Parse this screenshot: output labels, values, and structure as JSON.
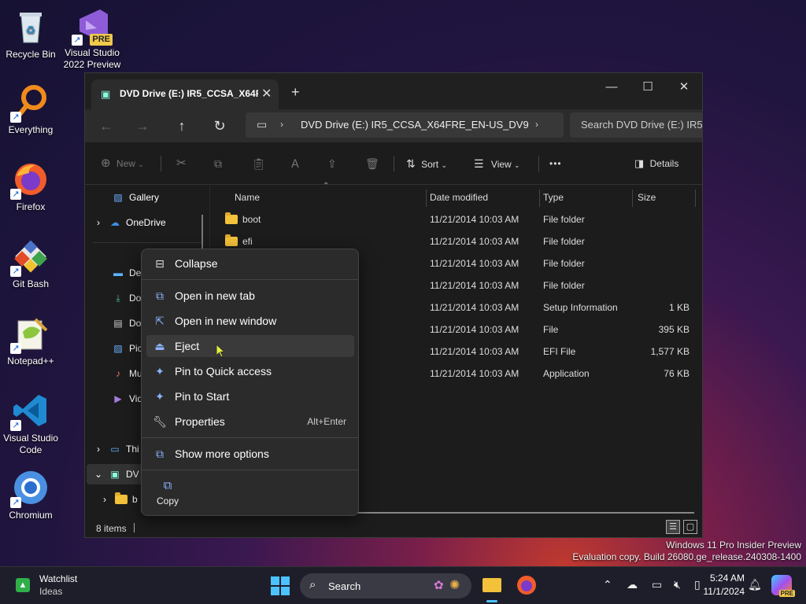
{
  "desktop": {
    "icons": [
      {
        "label": "Recycle Bin"
      },
      {
        "label": "Visual Studio 2022 Preview",
        "badge": "PRE"
      },
      {
        "label": "Everything"
      },
      {
        "label": "Firefox"
      },
      {
        "label": "Git Bash"
      },
      {
        "label": "Notepad++"
      },
      {
        "label": "Visual Studio Code"
      },
      {
        "label": "Chromium"
      }
    ]
  },
  "window": {
    "tab_title": "DVD Drive (E:) IR5_CCSA_X64F",
    "address": "DVD Drive (E:) IR5_CCSA_X64FRE_EN-US_DV9",
    "search_placeholder": "Search DVD Drive (E:) IR5",
    "commands": {
      "new": "New",
      "sort": "Sort",
      "view": "View",
      "more": "•••",
      "details": "Details"
    },
    "sidebar": {
      "gallery": "Gallery",
      "onedrive": "OneDrive",
      "items": [
        "Des",
        "Do",
        "Do",
        "Pic",
        "Mu",
        "Vid"
      ],
      "thispc": "Thi",
      "dvd": "DV",
      "sub": "b"
    },
    "columns": {
      "name": "Name",
      "date": "Date modified",
      "type": "Type",
      "size": "Size"
    },
    "rows": [
      {
        "name": "boot",
        "date": "11/21/2014 10:03 AM",
        "type": "File folder",
        "size": ""
      },
      {
        "name": "efi",
        "date": "11/21/2014 10:03 AM",
        "type": "File folder",
        "size": ""
      },
      {
        "name": "",
        "date": "11/21/2014 10:03 AM",
        "type": "File folder",
        "size": ""
      },
      {
        "name": "",
        "date": "11/21/2014 10:03 AM",
        "type": "File folder",
        "size": ""
      },
      {
        "name": "",
        "date": "11/21/2014 10:03 AM",
        "type": "Setup Information",
        "size": "1 KB"
      },
      {
        "name": "",
        "date": "11/21/2014 10:03 AM",
        "type": "File",
        "size": "395 KB"
      },
      {
        "name": "",
        "date": "11/21/2014 10:03 AM",
        "type": "EFI File",
        "size": "1,577 KB"
      },
      {
        "name": "",
        "date": "11/21/2014 10:03 AM",
        "type": "Application",
        "size": "76 KB"
      }
    ],
    "status": "8 items"
  },
  "context_menu": {
    "collapse": "Collapse",
    "open_new_tab": "Open in new tab",
    "open_new_window": "Open in new window",
    "eject": "Eject",
    "pin_quick": "Pin to Quick access",
    "pin_start": "Pin to Start",
    "properties": "Properties",
    "properties_shortcut": "Alt+Enter",
    "show_more": "Show more options",
    "copy": "Copy"
  },
  "watermark": {
    "line1": "Windows 11 Pro Insider Preview",
    "line2": "Evaluation copy. Build 26080.ge_release.240308-1400"
  },
  "taskbar": {
    "widget_title": "Watchlist",
    "widget_sub": "Ideas",
    "search": "Search",
    "time": "5:24 AM",
    "date": "11/1/2024",
    "copilot_badge": "PRE"
  }
}
